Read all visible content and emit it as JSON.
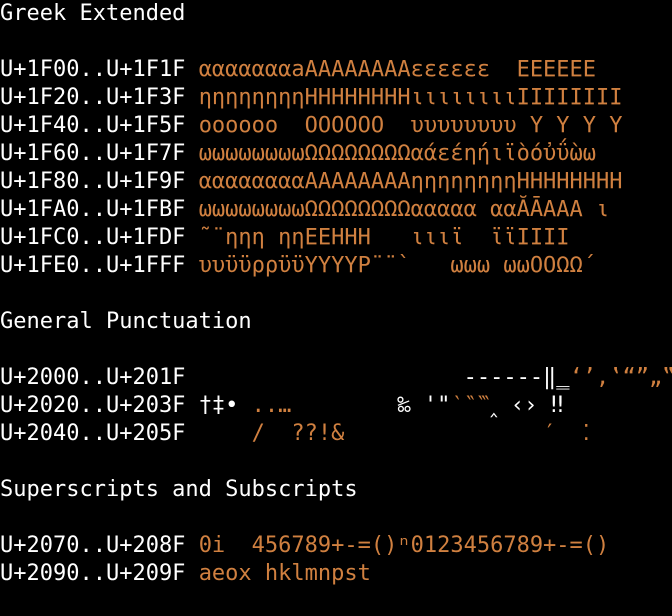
{
  "colors": {
    "background": "#000000",
    "text": "#ffffff",
    "glyph_accent": "#d08040"
  },
  "sections": [
    {
      "title": "Greek Extended",
      "rows": [
        {
          "range": "U+1F00..U+1F1F",
          "glyphs": "αααααααaΑΑΑΑΑΑΑΑεεεεεε  ΕΕΕΕΕΕ"
        },
        {
          "range": "U+1F20..U+1F3F",
          "glyphs": "ηηηηηηηηΗΗΗΗΗΗΗΗιιιιιιιιΙΙΙΙΙΙΙΙ"
        },
        {
          "range": "U+1F40..U+1F5F",
          "glyphs": "οοοοοο  ΟΟΟΟΟΟ  υυυυυυυυ Υ Υ Υ Υ"
        },
        {
          "range": "U+1F60..U+1F7F",
          "glyphs": "ωωωωωωωωΩΩΩΩΩΩΩΩαάεέηήιϊὸόὐΰὼω"
        },
        {
          "range": "U+1F80..U+1F9F",
          "glyphs": "ααααααααΑΑΑΑΑΑΑΑηηηηηηηηΗΗΗΗΗΗΗΗ"
        },
        {
          "range": "U+1FA0..U+1FBF",
          "glyphs": "ωωωωωωωωΩΩΩΩΩΩΩΩααααα ααĂĀΑΑΑ ι"
        },
        {
          "range": "U+1FC0..U+1FDF",
          "glyphs": "˜¨ηηη ηηΕΕΗΗΗ   ιιιϊ  ϊϊΙΙΙΙ"
        },
        {
          "range": "U+1FE0..U+1FFF",
          "glyphs": "υυϋϋρρϋϋΥΥΥΥΡ¨¨`   ωωω ωωΟΟΩΩ´"
        }
      ]
    },
    {
      "title": "General Punctuation",
      "rows": [
        {
          "range": "U+2000..U+201F",
          "glyphs_white": "                    ------‖‗",
          "glyphs_orange": "‘’‚‛“”„‟"
        },
        {
          "range": "U+2020..U+203F",
          "glyphs_white": "†‡•",
          "glyphs_orange": " ..…",
          "glyphs_white2": "        ‰ '\"",
          "glyphs_orange2": "‵‶‷",
          "glyphs_white3": "‸ ‹› ‼"
        },
        {
          "range": "U+2040..U+205F",
          "glyphs_orange": "    /  ??!&               ′  ⁚"
        }
      ]
    },
    {
      "title": "Superscripts and Subscripts",
      "rows": [
        {
          "range": "U+2070..U+208F",
          "glyphs": "⁰ⁱ  ⁴⁵⁶⁷⁸⁹⁺⁻⁼⁽⁾ⁿ₀₁₂₃₄₅₆₇₈₉₊₋₌₍₎",
          "display": "0i  456789+-=()ⁿ0123456789+-=()"
        },
        {
          "range": "U+2090..U+209F",
          "glyphs": "ₐₑₒₓ ₕₖₗₘₙₚₛₜ",
          "display": "aeox hklmnpst"
        }
      ]
    }
  ]
}
